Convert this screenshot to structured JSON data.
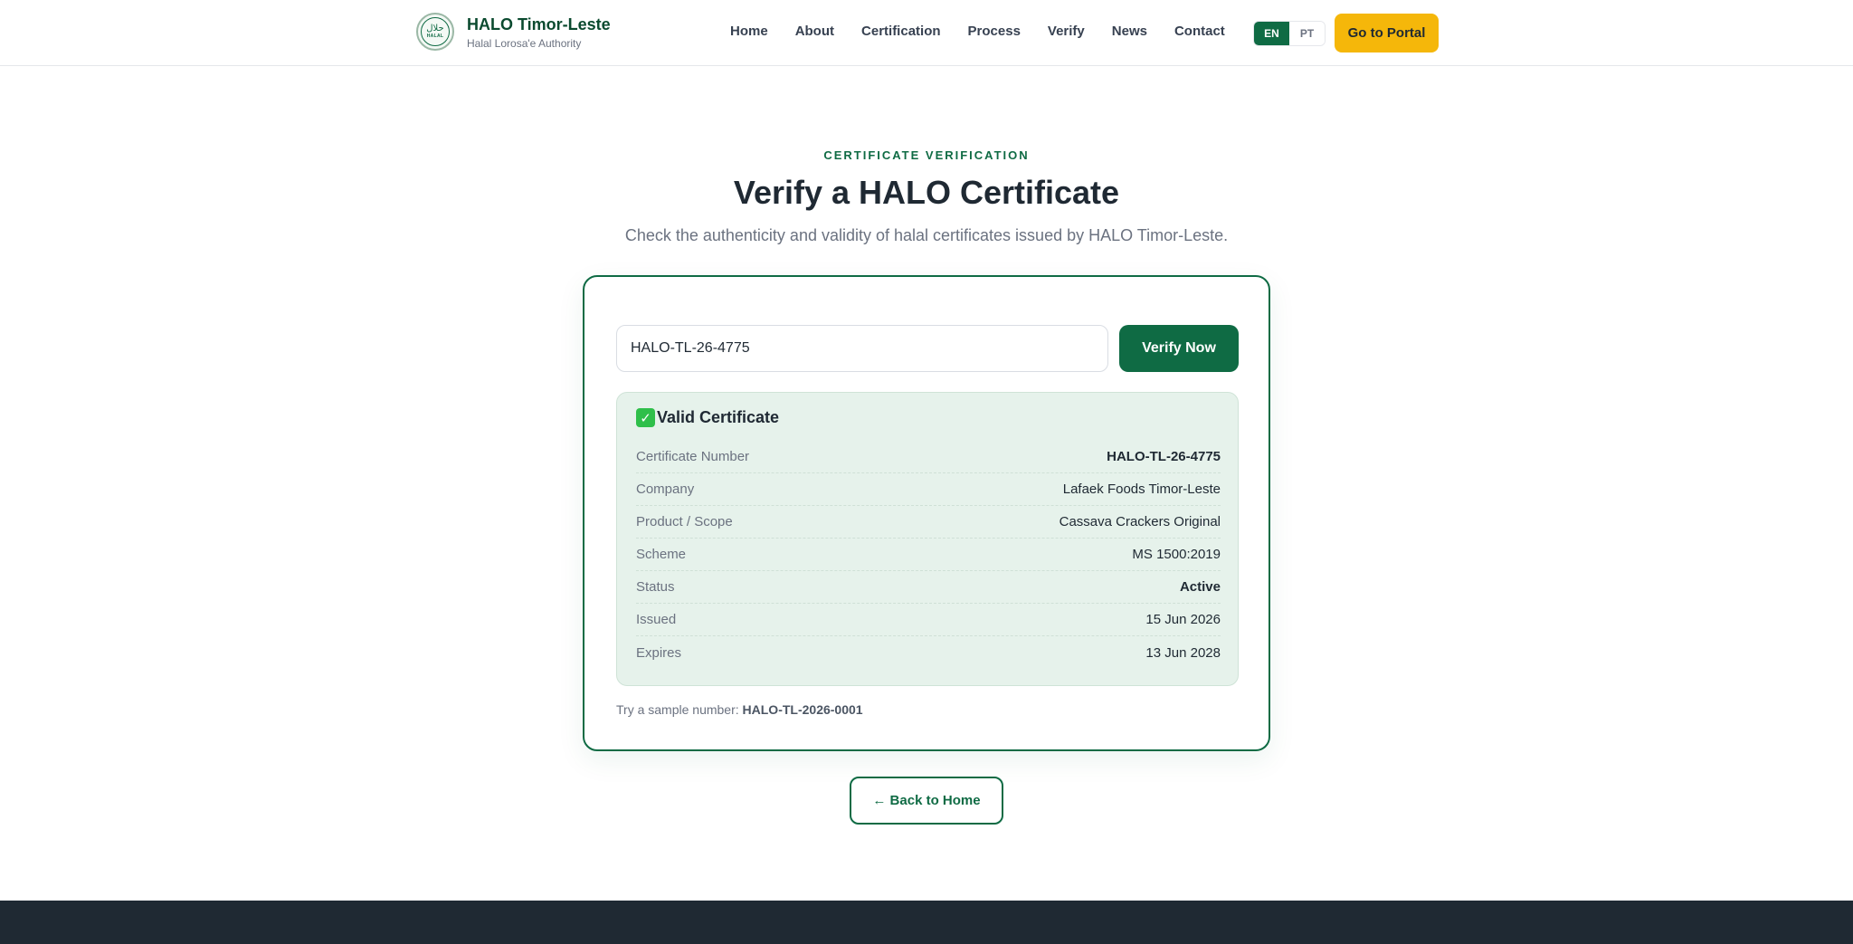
{
  "header": {
    "brand_title": "HALO Timor-Leste",
    "brand_sub": "Halal Lorosa'e Authority",
    "logo_ar": "حلال",
    "logo_latin": "HALAL",
    "nav": [
      "Home",
      "About",
      "Certification",
      "Process",
      "Verify",
      "News",
      "Contact"
    ],
    "lang_en": "EN",
    "lang_pt": "PT",
    "portal_label": "Go to Portal"
  },
  "hero": {
    "eyebrow": "CERTIFICATE VERIFICATION",
    "title": "Verify a HALO Certificate",
    "subtitle": "Check the authenticity and validity of halal certificates issued by HALO Timor-Leste."
  },
  "search": {
    "value": "HALO-TL-26-4775",
    "button_label": "Verify Now"
  },
  "result": {
    "title": "Valid Certificate",
    "rows": [
      {
        "label": "Certificate Number",
        "value": "HALO-TL-26-4775"
      },
      {
        "label": "Company",
        "value": "Lafaek Foods Timor-Leste"
      },
      {
        "label": "Product / Scope",
        "value": "Cassava Crackers Original"
      },
      {
        "label": "Scheme",
        "value": "MS 1500:2019"
      },
      {
        "label": "Status",
        "value": "Active"
      },
      {
        "label": "Issued",
        "value": "15 Jun 2026"
      },
      {
        "label": "Expires",
        "value": "13 Jun 2028"
      }
    ]
  },
  "sample": {
    "prefix": "Try a sample number:",
    "number": "HALO-TL-2026-0001"
  },
  "back_label": "← Back to Home",
  "colors": {
    "brand_green": "#0f6b44",
    "accent_yellow": "#f5b70a",
    "result_bg": "#e6f2eb",
    "footer_bg": "#1f2933"
  }
}
